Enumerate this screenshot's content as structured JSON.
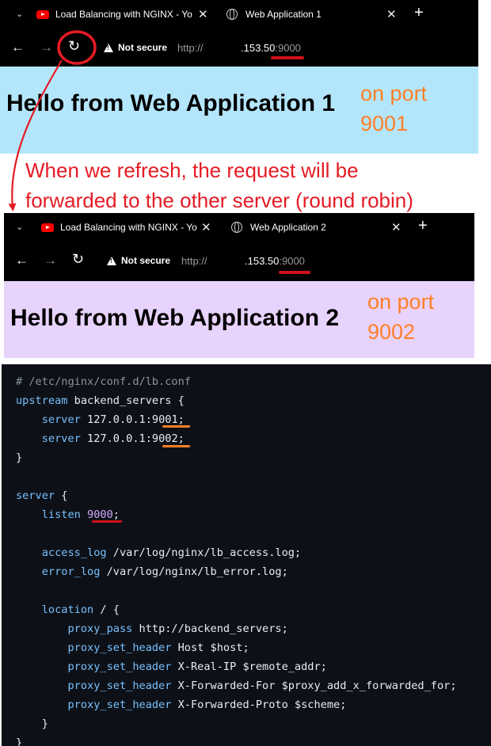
{
  "browser1": {
    "tab1_title": "Load Balancing with NGINX - Yo",
    "tab2_title": "Web Application 1",
    "security_label": "Not secure",
    "url_scheme": "http://",
    "url_host": ".153.50",
    "url_port": ":9000"
  },
  "page1": {
    "heading": "Hello from Web Application 1",
    "port_note_line1": "on port",
    "port_note_line2": "9001"
  },
  "annotation": {
    "line1": "When we refresh, the request will be",
    "line2": "forwarded to the other server (round robin)"
  },
  "browser2": {
    "tab1_title": "Load Balancing with NGINX - Yo",
    "tab2_title": "Web Application 2",
    "security_label": "Not secure",
    "url_scheme": "http://",
    "url_host": ".153.50",
    "url_port": ":9000"
  },
  "page2": {
    "heading": "Hello from Web Application 2",
    "port_note_line1": "on port",
    "port_note_line2": "9002"
  },
  "code": {
    "comment": "# /etc/nginx/conf.d/lb.conf",
    "upstream_kw": "upstream",
    "upstream_name": " backend_servers {",
    "server_kw": "server",
    "server1_addr": " 127.0.0.1:",
    "server1_port": "9001",
    "server2_addr": " 127.0.0.1:",
    "server2_port": "9002",
    "close1": "}",
    "server_block_kw": "server",
    "server_block_open": " {",
    "listen_kw": "listen",
    "listen_port": "9000",
    "access_log_kw": "access_log",
    "access_log_val": " /var/log/nginx/lb_access.log;",
    "error_log_kw": "error_log",
    "error_log_val": " /var/log/nginx/lb_error.log;",
    "location_kw": "location",
    "location_val": " / {",
    "proxy_pass_kw": "proxy_pass",
    "proxy_pass_val": " http://backend_servers;",
    "psh_kw": "proxy_set_header",
    "psh1_val": " Host $host;",
    "psh2_val": " X-Real-IP $remote_addr;",
    "psh3_val": " X-Forwarded-For $proxy_add_x_forwarded_for;",
    "psh4_val": " X-Forwarded-Proto $scheme;",
    "close_inner": "}",
    "close_outer": "}"
  },
  "colors": {
    "highlight_red": "#d0101b",
    "highlight_orange": "#ff7f27",
    "page1_bg": "#b4e6fb",
    "page2_bg": "#e8d3fc",
    "code_bg": "#0d1117"
  },
  "icons": [
    "chevron-down-icon",
    "youtube-icon",
    "close-icon",
    "globe-icon",
    "new-tab-icon",
    "back-arrow-icon",
    "forward-arrow-icon",
    "reload-icon",
    "warning-icon"
  ]
}
